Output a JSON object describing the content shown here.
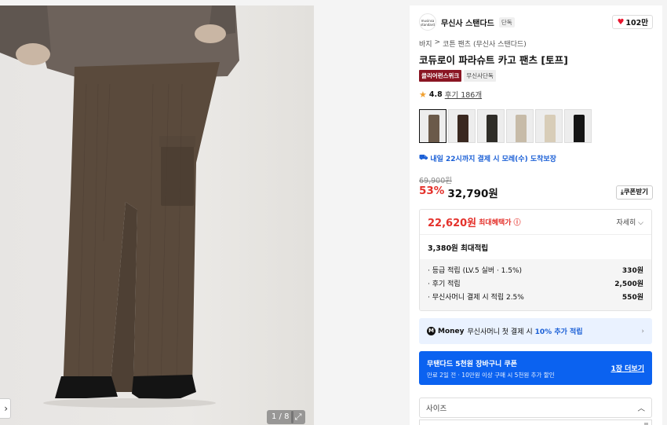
{
  "gallery": {
    "counter": "1 / 8",
    "prev_glyph": "›",
    "expand_glyph": "⤢",
    "pants_color": "#5a4a3c"
  },
  "brand": {
    "logo_text": "musinsa standard",
    "name": "무신사 스탠다드",
    "tag": "단독",
    "likes": "102만",
    "heart_icon": "heart-icon"
  },
  "breadcrumb": [
    "바지",
    "코튼 팬츠 (무신사 스탠다드)"
  ],
  "breadcrumb_sep": ">",
  "product": {
    "title": "코듀로이 파라슈트 카고 팬츠 [토프]",
    "badge_primary": "클리어런스위크",
    "badge_secondary": "무신사단독",
    "rating": "4.8",
    "reviews": "후기 186개"
  },
  "swatches": [
    {
      "color": "#6b5a4a",
      "selected": true
    },
    {
      "color": "#3a2820",
      "selected": false
    },
    {
      "color": "#2f2d28",
      "selected": false
    },
    {
      "color": "#c7bba8",
      "selected": false
    },
    {
      "color": "#d8cdb8",
      "selected": false
    },
    {
      "color": "#151515",
      "selected": false
    }
  ],
  "delivery": "내일 22시까지 결제 시 모레(수) 도착보장",
  "price": {
    "original": "69,900원",
    "discount": "53%",
    "sale": "32,790원",
    "coupon_button": "쿠폰받기"
  },
  "benefit": {
    "max_price": "22,620원",
    "max_label": "최대혜택가",
    "detail": "자세히",
    "points_title": "3,380원 최대적립",
    "rows": [
      {
        "label": "· 등급 적립 (LV.5 실버 · 1.5%)",
        "value": "330원"
      },
      {
        "label": "· 후기 적립",
        "value": "2,500원"
      },
      {
        "label": "· 무신사머니 결제 시 적립 2.5%",
        "value": "550원"
      }
    ]
  },
  "money_banner": {
    "icon": "M",
    "name": "Money",
    "text": "무신사머니 첫 결제 시",
    "highlight": "10% 추가 적립"
  },
  "coupon_banner": {
    "title": "무탠다드 5천원 장바구니 쿠폰",
    "subtitle": "만료 2일 전 · 10만원 이상 구매 시 5천원 추가 할인",
    "more": "1장 더보기"
  },
  "size": {
    "placeholder": "사이즈"
  },
  "colors": {
    "accent_red": "#e4312b",
    "accent_blue": "#1a5fd6",
    "banner_blue": "#0b62f0"
  }
}
